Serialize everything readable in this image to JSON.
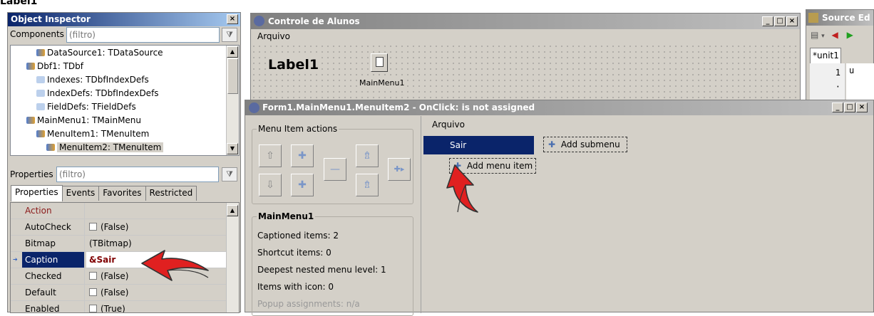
{
  "top_strip_text": "Label1",
  "object_inspector": {
    "title": "Object Inspector",
    "close_glyph": "×",
    "components_label": "Components",
    "components_filter_placeholder": "(filtro)",
    "tree": [
      {
        "text": "DataSource1: TDataSource",
        "depth": 2
      },
      {
        "text": "Dbf1: TDbf",
        "depth": 1
      },
      {
        "text": "Indexes: TDbfIndexDefs",
        "depth": 2
      },
      {
        "text": "IndexDefs: TDbfIndexDefs",
        "depth": 2
      },
      {
        "text": "FieldDefs: TFieldDefs",
        "depth": 2
      },
      {
        "text": "MainMenu1: TMainMenu",
        "depth": 1
      },
      {
        "text": "MenuItem1: TMenuItem",
        "depth": 2
      },
      {
        "text": "MenuItem2: TMenuItem",
        "depth": 3,
        "selected": true
      }
    ],
    "properties_label": "Properties",
    "properties_filter_placeholder": "(filtro)",
    "tabs": [
      "Properties",
      "Events",
      "Favorites",
      "Restricted"
    ],
    "active_tab": "Properties",
    "props": [
      {
        "key": "Action",
        "value": "",
        "checkbox": false,
        "red_key": true
      },
      {
        "key": "AutoCheck",
        "value": "(False)",
        "checkbox": true
      },
      {
        "key": "Bitmap",
        "value": "(TBitmap)",
        "checkbox": false
      },
      {
        "key": "Caption",
        "value": "&Sair",
        "checkbox": false,
        "selected": true
      },
      {
        "key": "Checked",
        "value": "(False)",
        "checkbox": true
      },
      {
        "key": "Default",
        "value": "(False)",
        "checkbox": true
      },
      {
        "key": "Enabled",
        "value": "(True)",
        "checkbox": true
      }
    ]
  },
  "form_window": {
    "title": "Controle de Alunos",
    "menu": "Arquivo",
    "label1": "Label1",
    "mainmenu_caption": "MainMenu1"
  },
  "source_editor": {
    "title": "Source Ed",
    "tab": "*unit1",
    "line_numbers": [
      "1",
      "·"
    ]
  },
  "menu_editor": {
    "title": "Form1.MainMenu1.MenuItem2 - OnClick: is not assigned",
    "actions_group": "Menu Item actions",
    "menu_bar_item": "Arquivo",
    "selected_item": "Sair",
    "add_submenu": "Add submenu",
    "add_menu_item": "Add menu item",
    "stats_group": "MainMenu1",
    "stats": [
      "Captioned items: 2",
      "Shortcut items: 0",
      "Deepest nested menu level: 1",
      "Items with icon: 0",
      "Popup assignments: n/a"
    ]
  },
  "colors": {
    "selection": "#0a246a",
    "arrow": "#e02020",
    "panel": "#d4d0c8"
  }
}
